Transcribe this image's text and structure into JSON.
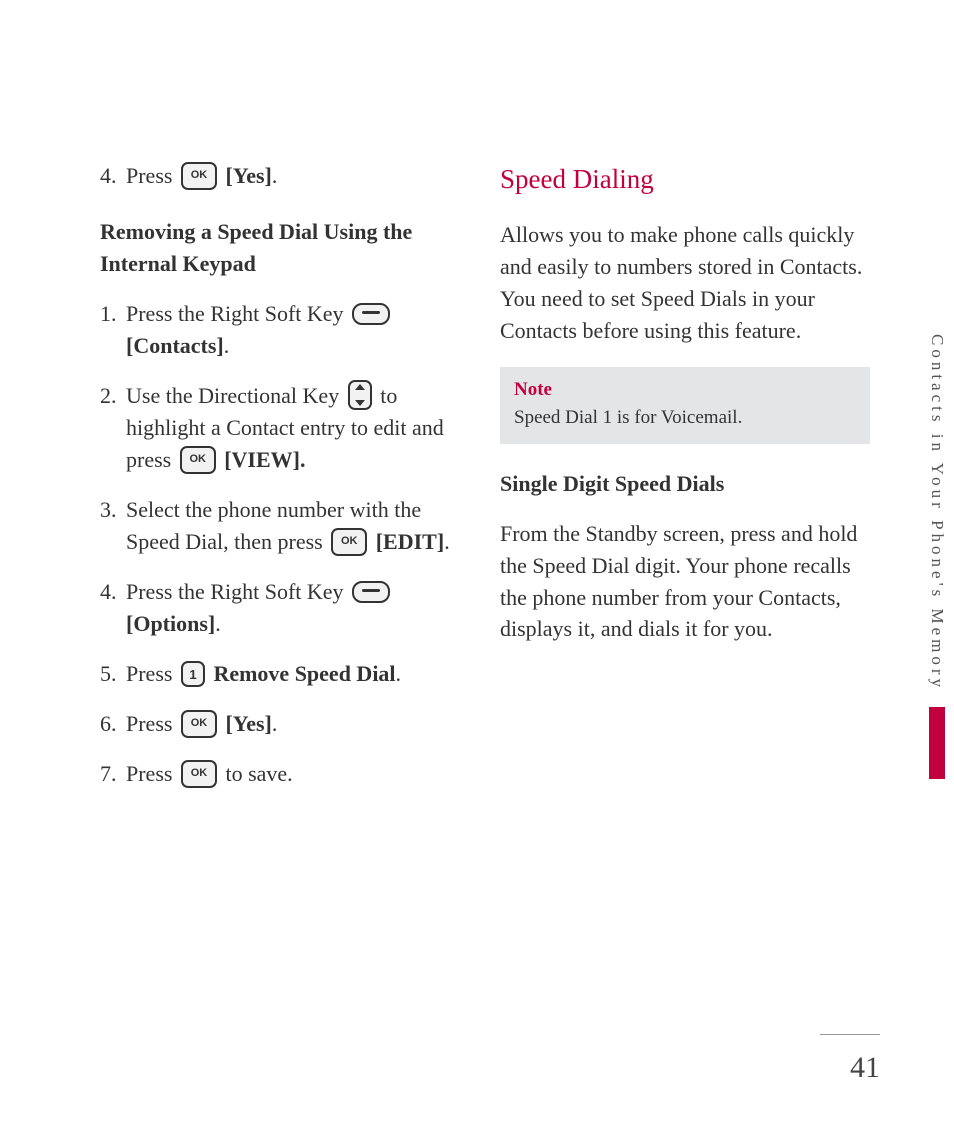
{
  "sideTab": "Contacts in Your Phone's Memory",
  "pageNumber": "41",
  "left": {
    "step4a_pre": "Press ",
    "step4a_bold": "[Yes]",
    "step4a_dot": ".",
    "sub1": "Removing a Speed Dial Using the Internal Keypad",
    "s1_pre": "Press the Right Soft Key ",
    "s1_bold": "[Contacts]",
    "s1_dot": ".",
    "s2_pre": "Use the Directional Key ",
    "s2_mid": " to highlight a Contact entry to edit and press ",
    "s2_bold": "[VIEW].",
    "s3_pre": "Select the phone number with the Speed Dial, then press ",
    "s3_bold": "[EDIT]",
    "s3_dot": ".",
    "s4_pre": "Press the Right Soft Key ",
    "s4_bold": "[Options]",
    "s4_dot": ".",
    "s5_pre": "Press ",
    "s5_bold": "Remove Speed Dial",
    "s5_dot": ".",
    "s6_pre": "Press ",
    "s6_bold": "[Yes]",
    "s6_dot": ".",
    "s7_pre": "Press ",
    "s7_post": " to save."
  },
  "right": {
    "title": "Speed Dialing",
    "intro": "Allows you to make phone calls quickly and easily to numbers stored in Contacts. You need to set Speed Dials in your Contacts before using this feature.",
    "noteTitle": "Note",
    "noteBody": "Speed Dial 1 is for Voicemail.",
    "sub": "Single Digit Speed Dials",
    "para": "From the Standby screen, press and hold the Speed Dial digit. Your phone recalls the phone number from your Contacts, displays it, and dials it for you."
  },
  "nums": {
    "n1": "1.",
    "n2": "2.",
    "n3": "3.",
    "n4": "4.",
    "n5": "5.",
    "n6": "6.",
    "n7": "7."
  },
  "keys": {
    "ok": "OK",
    "one": "1"
  }
}
